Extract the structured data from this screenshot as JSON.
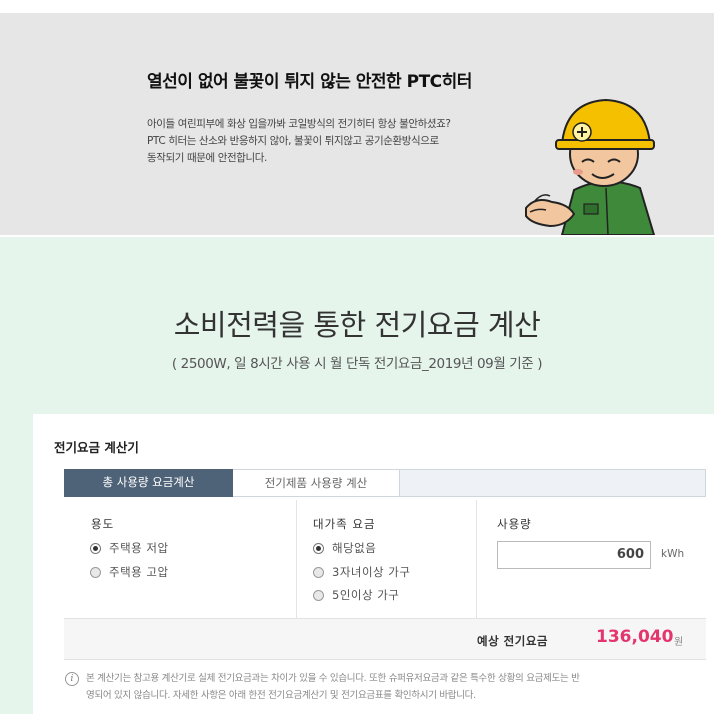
{
  "banner": {
    "title": "열선이 없어 불꽃이 튀지 않는 안전한 PTC히터",
    "desc_line1": "아이들 여린피부에 화상 입을까봐 코일방식의 전기히터 항상 불안하셨죠?",
    "desc_line2": "PTC 히터는 산소와 반응하지 않아, 불꽃이 튀지않고 공기순환방식으로",
    "desc_line3": "동작되기 때문에 안전합니다.",
    "illustration": "helmet-worker-illustration"
  },
  "section": {
    "title": "소비전력을 통한 전기요금 계산",
    "subtitle": "( 2500W, 일 8시간 사용 시 월 단독 전기요금_2019년 09월 기준 )"
  },
  "calculator": {
    "title": "전기요금 계산기",
    "tabs": [
      {
        "label": "총 사용량 요금계산",
        "active": true
      },
      {
        "label": "전기제품 사용량 계산",
        "active": false
      }
    ],
    "usage_type": {
      "heading": "용도",
      "options": [
        {
          "label": "주택용 저압",
          "checked": true
        },
        {
          "label": "주택용 고압",
          "checked": false
        }
      ]
    },
    "large_family": {
      "heading": "대가족 요금",
      "options": [
        {
          "label": "해당없음",
          "checked": true
        },
        {
          "label": "3자녀이상 가구",
          "checked": false
        },
        {
          "label": "5인이상 가구",
          "checked": false
        }
      ]
    },
    "consumption": {
      "heading": "사용량",
      "value": "600",
      "unit": "kWh"
    },
    "result": {
      "label": "예상 전기요금",
      "value": "136,040",
      "unit": "원"
    },
    "notice_line1": "본 계산기는 참고용 계산기로 실제 전기요금과는 차이가 있을 수 있습니다. 또한 슈퍼유저요금과 같은 특수한 상황의 요금제도는 반",
    "notice_line2": "영되어 있지 않습니다. 자세한 사항은 아래 한전 전기요금계산기 및 전기요금표를 확인하시기 바랍니다."
  },
  "colors": {
    "banner_bg": "#e6e6e6",
    "mint_bg": "#e5f5ec",
    "tab_active": "#4f6378",
    "price": "#e4356e"
  }
}
